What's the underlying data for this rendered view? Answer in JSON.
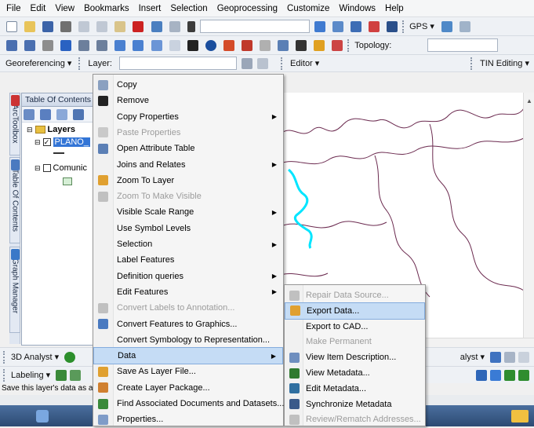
{
  "menubar": [
    "File",
    "Edit",
    "View",
    "Bookmarks",
    "Insert",
    "Selection",
    "Geoprocessing",
    "Customize",
    "Windows",
    "Help"
  ],
  "toolbar2": {
    "topology_label": "Topology:",
    "gps_label": "GPS ▾"
  },
  "toolbar3": {
    "georef_label": "Georeferencing ▾",
    "layer_label": "Layer:",
    "editor_label": "Editor ▾",
    "tin_label": "TIN Editing ▾"
  },
  "dock_tabs": [
    "ArcToolbox",
    "Table Of Contents",
    "Graph Manager"
  ],
  "toc": {
    "title": "Table Of Contents",
    "group": "Layers",
    "layer1": "PLANO_",
    "layer2": "Comunic"
  },
  "context_menu": [
    {
      "label": "Copy",
      "icon": "copy-icon",
      "disabled": false,
      "submenu": false
    },
    {
      "label": "Remove",
      "icon": "remove-icon",
      "disabled": false,
      "submenu": false
    },
    {
      "label": "Copy Properties",
      "icon": "",
      "disabled": false,
      "submenu": true
    },
    {
      "label": "Paste Properties",
      "icon": "paste-icon",
      "disabled": true,
      "submenu": false
    },
    {
      "label": "Open Attribute Table",
      "icon": "table-icon",
      "disabled": false,
      "submenu": false
    },
    {
      "label": "Joins and Relates",
      "icon": "",
      "disabled": false,
      "submenu": true
    },
    {
      "label": "Zoom To Layer",
      "icon": "zoom-layer-icon",
      "disabled": false,
      "submenu": false
    },
    {
      "label": "Zoom To Make Visible",
      "icon": "zoom-visible-icon",
      "disabled": true,
      "submenu": false
    },
    {
      "label": "Visible Scale Range",
      "icon": "",
      "disabled": false,
      "submenu": true
    },
    {
      "label": "Use Symbol Levels",
      "icon": "",
      "disabled": false,
      "submenu": false
    },
    {
      "label": "Selection",
      "icon": "",
      "disabled": false,
      "submenu": true
    },
    {
      "label": "Label Features",
      "icon": "",
      "disabled": false,
      "submenu": false
    },
    {
      "label": "Definition queries",
      "icon": "",
      "disabled": false,
      "submenu": true
    },
    {
      "label": "Edit Features",
      "icon": "",
      "disabled": false,
      "submenu": true
    },
    {
      "label": "Convert Labels to Annotation...",
      "icon": "convert-labels-icon",
      "disabled": true,
      "submenu": false
    },
    {
      "label": "Convert Features to Graphics...",
      "icon": "convert-graphics-icon",
      "disabled": false,
      "submenu": false
    },
    {
      "label": "Convert Symbology to Representation...",
      "icon": "",
      "disabled": false,
      "submenu": false
    },
    {
      "label": "Data",
      "icon": "",
      "disabled": false,
      "submenu": true,
      "highlighted": true
    },
    {
      "label": "Save As Layer File...",
      "icon": "save-layer-icon",
      "disabled": false,
      "submenu": false
    },
    {
      "label": "Create Layer Package...",
      "icon": "package-icon",
      "disabled": false,
      "submenu": false
    },
    {
      "label": "Find Associated Documents and Datasets...",
      "icon": "find-docs-icon",
      "disabled": false,
      "submenu": false
    },
    {
      "label": "Properties...",
      "icon": "properties-icon",
      "disabled": false,
      "submenu": false
    }
  ],
  "data_submenu": [
    {
      "label": "Repair Data Source...",
      "icon": "repair-icon",
      "disabled": true
    },
    {
      "label": "Export Data...",
      "icon": "export-data-icon",
      "disabled": false,
      "highlighted": true
    },
    {
      "label": "Export to CAD...",
      "icon": "",
      "disabled": false
    },
    {
      "label": "Make Permanent",
      "icon": "",
      "disabled": true
    },
    {
      "label": "View Item Description...",
      "icon": "item-description-icon",
      "disabled": false
    },
    {
      "label": "View Metadata...",
      "icon": "view-metadata-icon",
      "disabled": false
    },
    {
      "label": "Edit Metadata...",
      "icon": "edit-metadata-icon",
      "disabled": false
    },
    {
      "label": "Synchronize Metadata",
      "icon": "sync-metadata-icon",
      "disabled": false
    },
    {
      "label": "Review/Rematch Addresses...",
      "icon": "rematch-icon",
      "disabled": true
    }
  ],
  "bottom": {
    "analyst_3d": "3D Analyst ▾",
    "labeling": "Labeling ▾",
    "analyst_right": "alyst ▾"
  },
  "status_text": "Save this layer's data as a"
}
